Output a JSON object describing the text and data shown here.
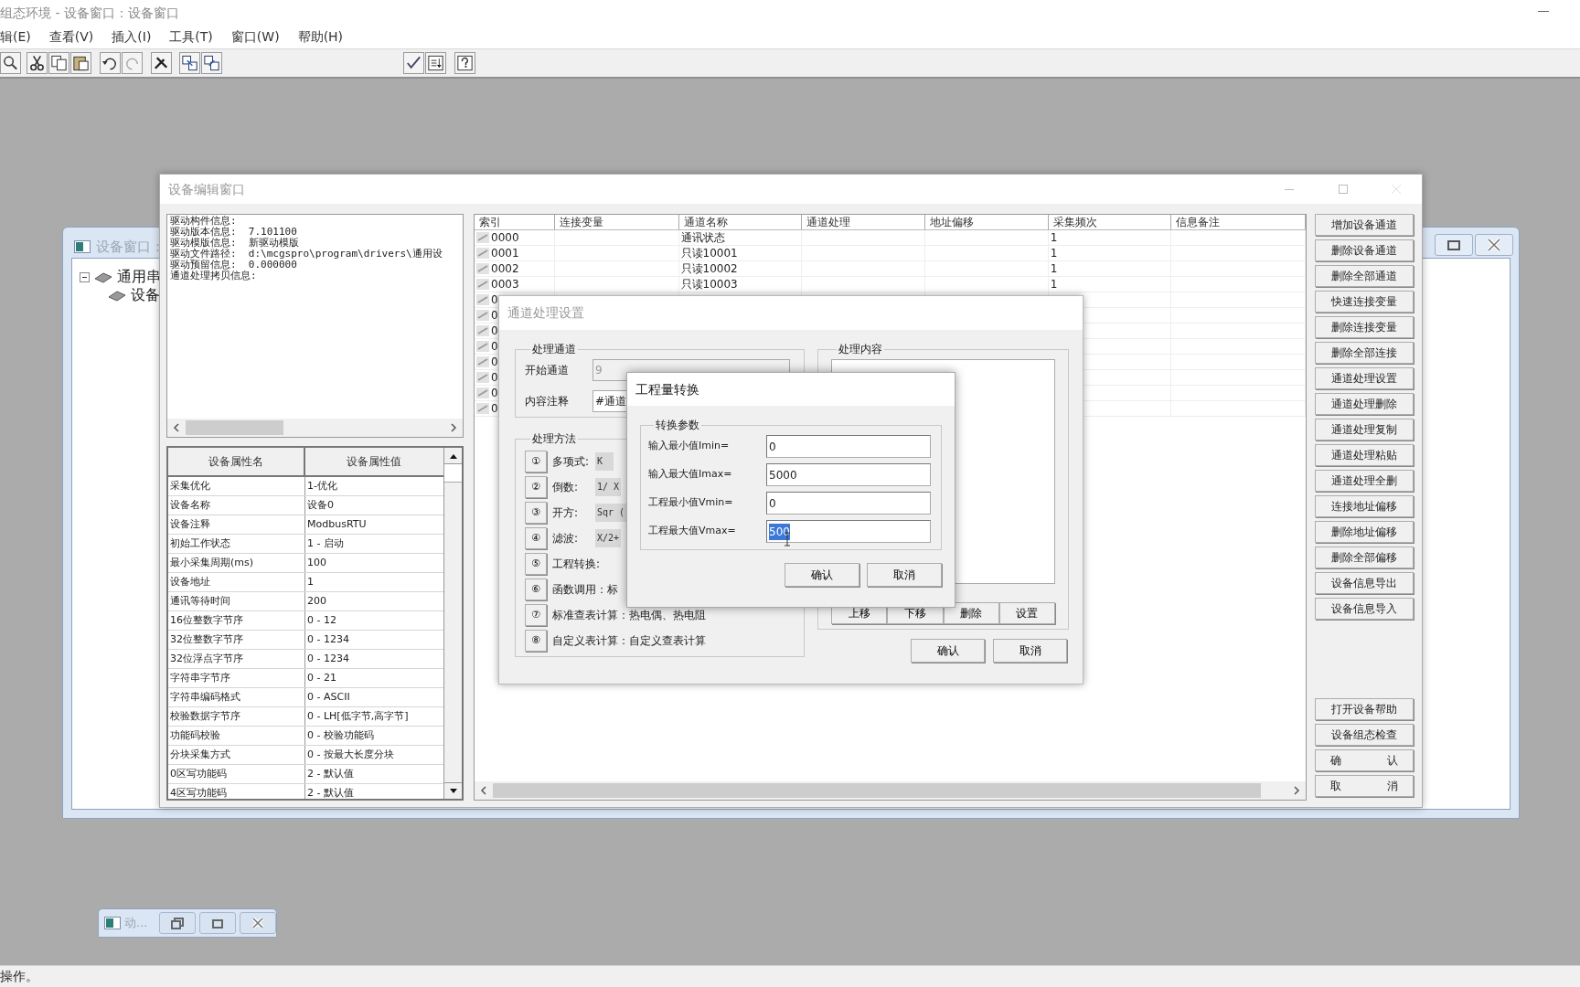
{
  "app": {
    "title": "组态环境 - 设备窗口：设备窗口",
    "menu": [
      "辑(E)",
      "查看(V)",
      "插入(I)",
      "工具(T)",
      "窗口(W)",
      "帮助(H)"
    ],
    "status": "操作。"
  },
  "device_window": {
    "title": "设备窗口：",
    "tree": [
      {
        "label": "通用串",
        "expanded": true,
        "children": [
          {
            "label": "设备"
          }
        ]
      }
    ]
  },
  "editor": {
    "title": "设备编辑窗口",
    "info_lines": [
      "驱动构件信息:",
      "驱动版本信息:  7.101100",
      "驱动模版信息:  新驱动模版",
      "驱动文件路径:  d:\\mcgspro\\program\\drivers\\通用设",
      "驱动预留信息:  0.000000",
      "通道处理拷贝信息:"
    ],
    "properties": {
      "columns": [
        "设备属性名",
        "设备属性值"
      ],
      "rows": [
        [
          "采集优化",
          "1-优化"
        ],
        [
          "设备名称",
          "设备0"
        ],
        [
          "设备注释",
          "ModbusRTU"
        ],
        [
          "初始工作状态",
          "1 - 启动"
        ],
        [
          "最小采集周期(ms)",
          "100"
        ],
        [
          "设备地址",
          "1"
        ],
        [
          "通讯等待时间",
          "200"
        ],
        [
          "16位整数字节序",
          "0 - 12"
        ],
        [
          "32位整数字节序",
          "0 - 1234"
        ],
        [
          "32位浮点字节序",
          "0 - 1234"
        ],
        [
          "字符串字节序",
          "0 - 21"
        ],
        [
          "字符串编码格式",
          "0 - ASCII"
        ],
        [
          "校验数据字节序",
          "0 - LH[低字节,高字节]"
        ],
        [
          "功能码校验",
          "0 - 校验功能码"
        ],
        [
          "分块采集方式",
          "0 - 按最大长度分块"
        ],
        [
          "0区写功能码",
          "2 - 默认值"
        ],
        [
          "4区写功能码",
          "2 - 默认值"
        ]
      ]
    },
    "channels": {
      "columns": [
        "索引",
        "连接变量",
        "通道名称",
        "通道处理",
        "地址偏移",
        "采集频次",
        "信息备注"
      ],
      "rows": [
        {
          "index": "0000",
          "name": "通讯状态",
          "frequency": "1"
        },
        {
          "index": "0001",
          "name": "只读10001",
          "frequency": "1"
        },
        {
          "index": "0002",
          "name": "只读10002",
          "frequency": "1"
        },
        {
          "index": "0003",
          "name": "只读10003",
          "frequency": "1"
        },
        {
          "index": "0"
        },
        {
          "index": "0"
        },
        {
          "index": "0"
        },
        {
          "index": "0"
        },
        {
          "index": "0"
        },
        {
          "index": "0"
        },
        {
          "index": "0"
        },
        {
          "index": "0"
        }
      ]
    },
    "buttons": [
      "增加设备通道",
      "删除设备通道",
      "删除全部通道",
      "快速连接变量",
      "删除连接变量",
      "删除全部连接",
      "通道处理设置",
      "通道处理删除",
      "通道处理复制",
      "通道处理粘贴",
      "通道处理全删",
      "连接地址偏移",
      "删除地址偏移",
      "删除全部偏移",
      "设备信息导出",
      "设备信息导入"
    ],
    "bottom_buttons": [
      "打开设备帮助",
      "设备组态检查",
      "确 认",
      "取 消"
    ]
  },
  "processing_dialog": {
    "title": "通道处理设置",
    "channel_group": {
      "legend": "处理通道",
      "fields": [
        {
          "label": "开始通道",
          "value": "9",
          "disabled": true
        },
        {
          "label": "内容注释",
          "value": "#通道",
          "disabled": false
        }
      ]
    },
    "method_group": {
      "legend": "处理方法",
      "methods": [
        {
          "number": "①",
          "label": "多项式:",
          "formula": "K"
        },
        {
          "number": "②",
          "label": "倒数:",
          "formula": "1/ X"
        },
        {
          "number": "③",
          "label": "开方:",
          "formula": "Sqr ("
        },
        {
          "number": "④",
          "label": "滤波:",
          "formula": "X/2+"
        },
        {
          "number": "⑤",
          "label": "工程转换:"
        },
        {
          "number": "⑥",
          "label": "函数调用：标"
        },
        {
          "number": "⑦",
          "label": "标准查表计算：热电偶、热电阻"
        },
        {
          "number": "⑧",
          "label": "自定义表计算：自定义查表计算"
        }
      ]
    },
    "content_group": {
      "legend": "处理内容",
      "buttons": [
        "上移",
        "下移",
        "删除",
        "设置"
      ]
    },
    "buttons": [
      "确认",
      "取消"
    ]
  },
  "conversion_dialog": {
    "title": "工程量转换",
    "legend": "转换参数",
    "fields": [
      {
        "label": "输入最小值Imin=",
        "value": "0",
        "selected": false
      },
      {
        "label": "输入最大值Imax=",
        "value": "5000",
        "selected": false
      },
      {
        "label": "工程最小值Vmin=",
        "value": "0",
        "selected": false
      },
      {
        "label": "工程最大值Vmax=",
        "value": "500",
        "selected": true
      }
    ],
    "buttons": [
      "确认",
      "取消"
    ]
  },
  "minimized_window": {
    "title": "动..."
  }
}
